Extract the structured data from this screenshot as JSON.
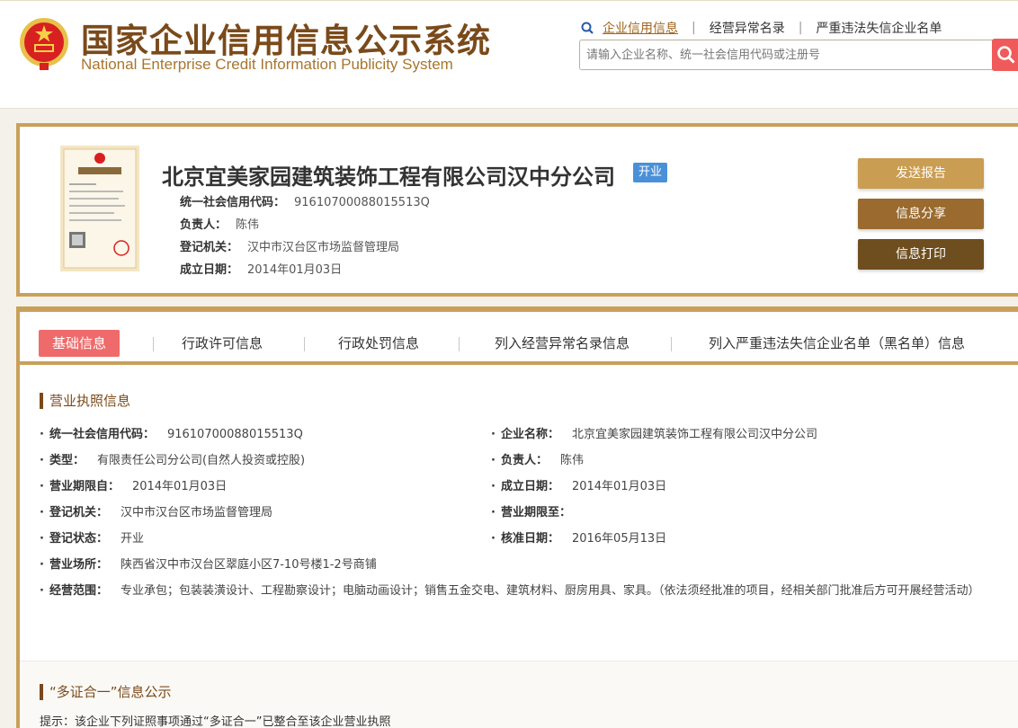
{
  "header": {
    "title_cn": "国家企业信用信息公示系统",
    "title_en": "National Enterprise Credit Information Publicity System",
    "nav": [
      "企业信用信息",
      "经营异常名录",
      "严重违法失信企业名单"
    ],
    "search_placeholder": "请输入企业名称、统一社会信用代码或注册号"
  },
  "company": {
    "name": "北京宜美家园建筑装饰工程有限公司汉中分公司",
    "status": "开业",
    "summary": [
      {
        "label": "统一社会信用代码：",
        "value": "91610700088015513Q"
      },
      {
        "label": "负责人：",
        "value": "陈伟"
      },
      {
        "label": "登记机关：",
        "value": "汉中市汉台区市场监督管理局"
      },
      {
        "label": "成立日期：",
        "value": "2014年01月03日"
      }
    ],
    "actions": [
      "发送报告",
      "信息分享",
      "信息打印"
    ]
  },
  "tabs": [
    "基础信息",
    "行政许可信息",
    "行政处罚信息",
    "列入经营异常名录信息",
    "列入严重违法失信企业名单（黑名单）信息"
  ],
  "license": {
    "section_title": "营业执照信息",
    "left": [
      {
        "label": "统一社会信用代码：",
        "value": "91610700088015513Q"
      },
      {
        "label": "类型：",
        "value": "有限责任公司分公司(自然人投资或控股)"
      },
      {
        "label": "营业期限自：",
        "value": "2014年01月03日"
      },
      {
        "label": "登记机关：",
        "value": "汉中市汉台区市场监督管理局"
      },
      {
        "label": "登记状态：",
        "value": "开业"
      },
      {
        "label": "营业场所：",
        "value": "陕西省汉中市汉台区翠庭小区7-10号楼1-2号商铺"
      }
    ],
    "right": [
      {
        "label": "企业名称：",
        "value": "北京宜美家园建筑装饰工程有限公司汉中分公司"
      },
      {
        "label": "负责人：",
        "value": "陈伟"
      },
      {
        "label": "成立日期：",
        "value": "2014年01月03日"
      },
      {
        "label": "营业期限至：",
        "value": ""
      },
      {
        "label": "核准日期：",
        "value": "2016年05月13日"
      }
    ],
    "scope_label": "经营范围：",
    "scope_value": "专业承包；包装装潢设计、工程勘察设计；电脑动画设计；销售五金交电、建筑材料、厨房用具、家具。（依法须经批准的项目，经相关部门批准后方可开展经营活动）"
  },
  "multi_cert": {
    "section_title": "“多证合一”信息公示",
    "tip": "提示：该企业下列证照事项通过“多证合一”已整合至该企业营业执照"
  },
  "colors": {
    "gold": "#c9a05a",
    "brown": "#7a4a1a",
    "btn_send": "#c99d52",
    "btn_share": "#9a6a2e",
    "btn_print": "#6e4e1e",
    "tab_active": "#ef6b6b",
    "search_btn": "#f05a5a",
    "badge": "#4a90d9"
  }
}
